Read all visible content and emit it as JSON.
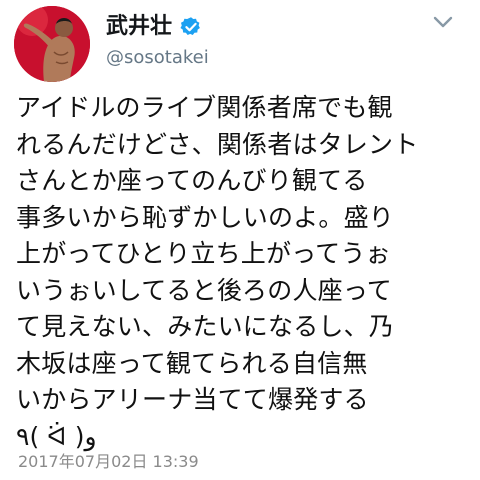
{
  "tweet": {
    "display_name": "武井壮",
    "handle": "@sosotakei",
    "verified": true,
    "text": "アイドルのライブ関係者席でも観\nれるんだけどさ、関係者はタレント\nさんとか座ってのんびり観てる\n事多いから恥ずかしいのよ。盛り\n上がってひとり立ち上がってうぉ\nいうぉいしてると後ろの人座って\nて見えない、みたいになるし、乃\n木坂は座って観てられる自信無\nいからアリーナ当てて爆発する\n٩( ᐛ )و",
    "timestamp": "2017年07月02日 13:39",
    "icons": {
      "verified": "verified-badge-icon",
      "menu": "chevron-down-icon"
    },
    "colors": {
      "verified_badge": "#1da1f2",
      "handle": "#657786",
      "timestamp": "#8a8a8a",
      "avatar_background": "#c8102e"
    }
  }
}
